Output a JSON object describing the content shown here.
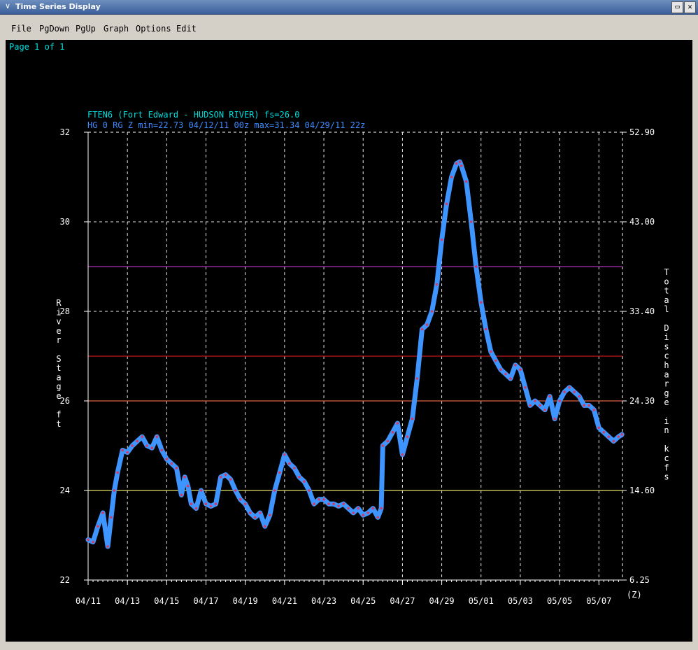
{
  "window": {
    "title": "Time Series Display",
    "menu_arrow_glyph": "∨",
    "minimize_glyph": "▭",
    "close_glyph": "✕"
  },
  "menu": {
    "items": [
      "File",
      "PgDown",
      "PgUp",
      "Graph",
      "Options",
      "Edit"
    ]
  },
  "page_indicator": "Page 1 of 1",
  "header": {
    "line1": "FTEN6 (Fort Edward - HUDSON RIVER) fs=26.0",
    "line2": "HG 0 RG Z min=22.73 04/12/11 00z max=31.34 04/29/11 22z"
  },
  "colors": {
    "background": "#000000",
    "header_line1": "#00dcdc",
    "header_line2": "#3c8cff",
    "series_fill": "#3f95ff",
    "series_marker": "#d23c64",
    "grid": "#ffffff",
    "text": "#ffffff"
  },
  "chart_data": {
    "type": "line",
    "ylabel": "River Stage ft",
    "y2label": "Total Discharge in kcfs",
    "xlabel": "(Z)",
    "ylim": [
      22,
      32
    ],
    "yticks": [
      "22",
      "24",
      "26",
      "28",
      "30",
      "32"
    ],
    "y2ticks": [
      "6.25",
      "14.60",
      "24.30",
      "33.40",
      "43.00",
      "52.90"
    ],
    "xticks": [
      "04/11",
      "04/13",
      "04/15",
      "04/17",
      "04/19",
      "04/21",
      "04/23",
      "04/25",
      "04/27",
      "04/29",
      "05/01",
      "05/03",
      "05/05",
      "05/07"
    ],
    "x_range_days": [
      0,
      27.2
    ],
    "grid": true,
    "thresholds": [
      {
        "value": 29,
        "color": "#b030b0"
      },
      {
        "value": 27,
        "color": "#c01818"
      },
      {
        "value": 26,
        "color": "#e06040"
      },
      {
        "value": 24,
        "color": "#e0e060"
      }
    ],
    "series": [
      {
        "x": [
          "04/11 00z",
          "04/11 06z",
          "04/11 12z",
          "04/11 18z",
          "04/12 00z",
          "04/12 04z",
          "04/12 08z",
          "04/12 12z",
          "04/12 18z",
          "04/13 00z",
          "04/13 06z",
          "04/13 12z",
          "04/13 18z",
          "04/14 00z",
          "04/14 06z",
          "04/14 12z",
          "04/14 18z",
          "04/15 00z",
          "04/15 06z",
          "04/15 12z",
          "04/15 18z",
          "04/15 22z",
          "04/16 02z",
          "04/16 06z",
          "04/16 12z",
          "04/16 18z",
          "04/17 00z",
          "04/17 06z",
          "04/17 12z",
          "04/17 18z",
          "04/18 00z",
          "04/18 06z",
          "04/18 12z",
          "04/18 18z",
          "04/19 00z",
          "04/19 06z",
          "04/19 12z",
          "04/19 18z",
          "04/20 00z",
          "04/20 06z",
          "04/20 12z",
          "04/20 18z",
          "04/21 00z",
          "04/21 06z",
          "04/21 12z",
          "04/21 18z",
          "04/22 00z",
          "04/22 06z",
          "04/22 12z",
          "04/22 18z",
          "04/23 00z",
          "04/23 06z",
          "04/23 12z",
          "04/23 18z",
          "04/24 00z",
          "04/24 06z",
          "04/24 12z",
          "04/24 18z",
          "04/25 00z",
          "04/25 06z",
          "04/25 12z",
          "04/25 18z",
          "04/25 22z",
          "04/26 00z",
          "04/26 06z",
          "04/26 12z",
          "04/26 18z",
          "04/27 00z",
          "04/27 06z",
          "04/27 12z",
          "04/27 18z",
          "04/28 00z",
          "04/28 06z",
          "04/28 12z",
          "04/28 18z",
          "04/29 00z",
          "04/29 06z",
          "04/29 12z",
          "04/29 18z",
          "04/29 22z",
          "04/30 00z",
          "04/30 06z",
          "04/30 12z",
          "04/30 18z",
          "05/01 00z",
          "05/01 06z",
          "05/01 12z",
          "05/01 18z",
          "05/02 00z",
          "05/02 06z",
          "05/02 12z",
          "05/02 18z",
          "05/03 00z",
          "05/03 06z",
          "05/03 12z",
          "05/03 18z",
          "05/04 00z",
          "05/04 06z",
          "05/04 12z",
          "05/04 18z",
          "05/05 00z",
          "05/05 06z",
          "05/05 12z",
          "05/05 18z",
          "05/06 00z",
          "05/06 06z",
          "05/06 12z",
          "05/06 18z",
          "05/07 00z",
          "05/07 06z",
          "05/07 12z",
          "05/07 18z",
          "05/08 00z",
          "05/08 04z"
        ],
        "days": [
          0,
          0.25,
          0.5,
          0.75,
          1.0,
          1.17,
          1.33,
          1.5,
          1.75,
          2.0,
          2.25,
          2.5,
          2.75,
          3.0,
          3.25,
          3.5,
          3.75,
          4.0,
          4.25,
          4.5,
          4.75,
          4.92,
          5.08,
          5.25,
          5.5,
          5.75,
          6.0,
          6.25,
          6.5,
          6.75,
          7.0,
          7.25,
          7.5,
          7.75,
          8.0,
          8.25,
          8.5,
          8.75,
          9.0,
          9.25,
          9.5,
          9.75,
          10.0,
          10.25,
          10.5,
          10.75,
          11.0,
          11.25,
          11.5,
          11.75,
          12.0,
          12.25,
          12.5,
          12.75,
          13.0,
          13.25,
          13.5,
          13.75,
          14.0,
          14.25,
          14.5,
          14.75,
          14.92,
          15.0,
          15.25,
          15.5,
          15.75,
          16.0,
          16.25,
          16.5,
          16.75,
          17.0,
          17.25,
          17.5,
          17.75,
          18.0,
          18.25,
          18.5,
          18.75,
          18.92,
          19.0,
          19.25,
          19.5,
          19.75,
          20.0,
          20.25,
          20.5,
          20.75,
          21.0,
          21.25,
          21.5,
          21.75,
          22.0,
          22.25,
          22.5,
          22.75,
          23.0,
          23.25,
          23.5,
          23.75,
          24.0,
          24.25,
          24.5,
          24.75,
          25.0,
          25.25,
          25.5,
          25.75,
          26.0,
          26.25,
          26.5,
          26.75,
          27.0,
          27.17
        ],
        "values": [
          22.9,
          22.85,
          23.2,
          23.5,
          22.75,
          23.4,
          24.0,
          24.4,
          24.9,
          24.85,
          25.0,
          25.1,
          25.2,
          25.0,
          24.95,
          25.2,
          24.9,
          24.7,
          24.6,
          24.5,
          23.9,
          24.3,
          24.1,
          23.7,
          23.6,
          24.0,
          23.7,
          23.65,
          23.7,
          24.3,
          24.35,
          24.25,
          24.0,
          23.8,
          23.7,
          23.5,
          23.4,
          23.5,
          23.2,
          23.45,
          24.0,
          24.4,
          24.8,
          24.6,
          24.5,
          24.3,
          24.2,
          24.0,
          23.7,
          23.8,
          23.8,
          23.7,
          23.7,
          23.65,
          23.7,
          23.6,
          23.5,
          23.6,
          23.45,
          23.5,
          23.6,
          23.4,
          23.6,
          25.0,
          25.1,
          25.3,
          25.5,
          24.8,
          25.2,
          25.6,
          26.5,
          27.6,
          27.7,
          28.0,
          28.6,
          29.6,
          30.4,
          31.0,
          31.3,
          31.34,
          31.25,
          30.9,
          30.0,
          29.0,
          28.2,
          27.6,
          27.1,
          26.9,
          26.7,
          26.6,
          26.5,
          26.8,
          26.7,
          26.3,
          25.9,
          26.0,
          25.9,
          25.8,
          26.1,
          25.6,
          26.0,
          26.2,
          26.3,
          26.2,
          26.1,
          25.9,
          25.9,
          25.8,
          25.4,
          25.3,
          25.2,
          25.1,
          25.2,
          25.25
        ]
      }
    ]
  }
}
